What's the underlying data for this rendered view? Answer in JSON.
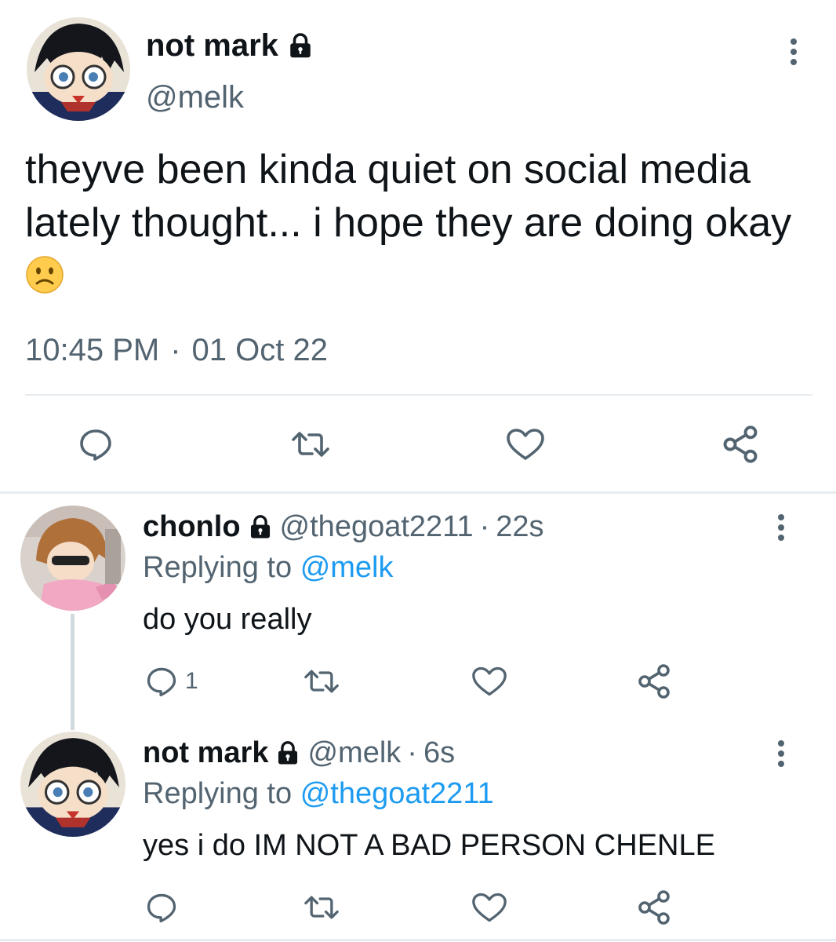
{
  "main_tweet": {
    "display_name": "not mark",
    "handle": "@melk",
    "text": "theyve been kinda quiet on social media lately thought... i hope they are doing okay",
    "emoji": "slightly-frowning-face",
    "time": "10:45 PM",
    "separator": "·",
    "date": "01 Oct 22"
  },
  "replies": [
    {
      "display_name": "chonlo",
      "handle": "@thegoat2211",
      "separator": "·",
      "time": "22s",
      "replying_prefix": "Replying to",
      "replying_to": "@melk",
      "text": "do you really",
      "reply_count": "1"
    },
    {
      "display_name": "not mark",
      "handle": "@melk",
      "separator": "·",
      "time": "6s",
      "replying_prefix": "Replying to",
      "replying_to": "@thegoat2211",
      "text": "yes i do IM NOT A BAD PERSON CHENLE"
    }
  ],
  "icons": {
    "reply": "reply-icon",
    "retweet": "retweet-icon",
    "like": "heart-icon",
    "share": "share-icon",
    "protected": "lock-icon",
    "more": "more-vertical-icon"
  },
  "colors": {
    "text_primary": "#0f1419",
    "text_secondary": "#536471",
    "link": "#1d9bf0",
    "divider": "#e6ecf0"
  }
}
